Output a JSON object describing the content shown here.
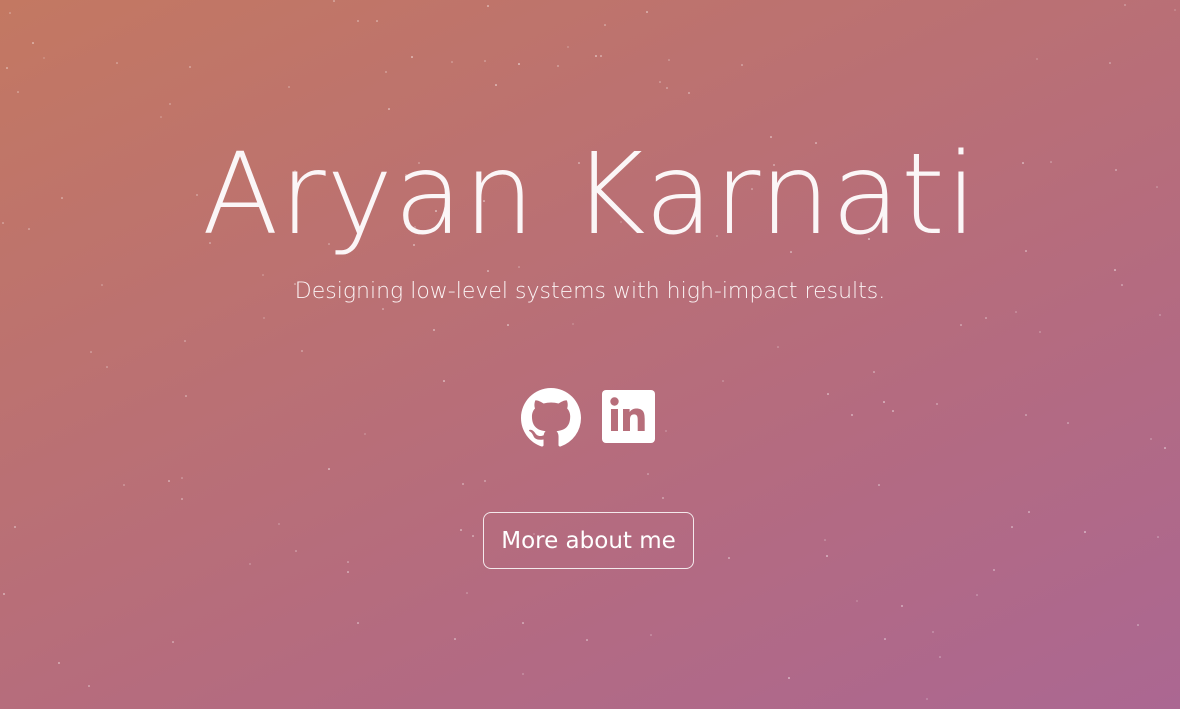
{
  "hero": {
    "name": "Aryan Karnati",
    "tagline": "Designing low-level systems with high-impact results."
  },
  "socials": [
    {
      "name": "GitHub",
      "icon": "github-icon"
    },
    {
      "name": "LinkedIn",
      "icon": "linkedin-icon"
    }
  ],
  "cta": {
    "label": "More about me"
  },
  "colors": {
    "gradient_start": "#c37862",
    "gradient_end": "#ab6792",
    "text": "#ffffff"
  }
}
